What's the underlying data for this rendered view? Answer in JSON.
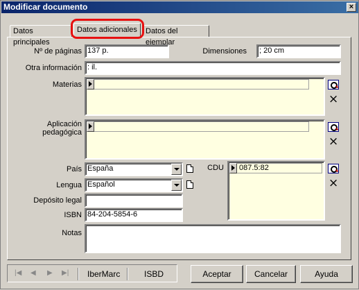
{
  "window": {
    "title": "Modificar documento"
  },
  "tabs": [
    "Datos principales",
    "Datos adicionales",
    "Datos del ejemplar"
  ],
  "fields": {
    "paginas": {
      "label": "Nº de páginas",
      "value": "137 p."
    },
    "dimensiones": {
      "label": "Dimensiones",
      "value": "; 20 cm"
    },
    "otra": {
      "label": "Otra información",
      "value": ": il."
    },
    "materias": {
      "label": "Materias"
    },
    "aplicacion": {
      "label1": "Aplicación",
      "label2": "pedagógica"
    },
    "pais": {
      "label": "País",
      "value": "España"
    },
    "lengua": {
      "label": "Lengua",
      "value": "Español"
    },
    "cdu": {
      "label": "CDU",
      "value": "087.5:82"
    },
    "deposito": {
      "label": "Depósito legal",
      "value": ""
    },
    "isbn": {
      "label": "ISBN",
      "value": "84-204-5854-6"
    },
    "notas": {
      "label": "Notas",
      "value": ""
    }
  },
  "nav": {
    "ibermarc": "IberMarc",
    "isbd": "ISBD",
    "icons": [
      "first-icon",
      "prev-icon",
      "next-icon",
      "last-icon"
    ]
  },
  "buttons": {
    "aceptar": "Aceptar",
    "cancelar": "Cancelar",
    "ayuda": "Ayuda"
  },
  "icons": {
    "close": "×",
    "delete": "×"
  },
  "colors": {
    "highlight": "#e81010",
    "list_bg": "#ffffe1",
    "title_bg": "#0a246a"
  }
}
